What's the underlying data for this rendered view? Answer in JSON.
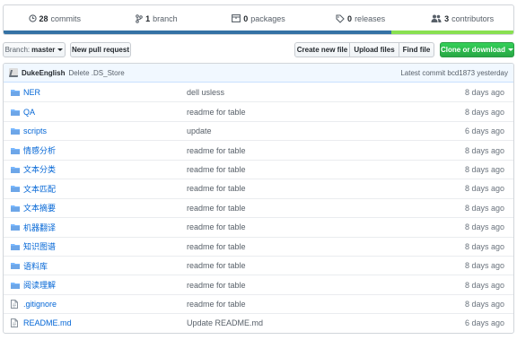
{
  "summary": {
    "commits_count": "28",
    "commits_label": "commits",
    "branch_count": "1",
    "branch_label": "branch",
    "packages_count": "0",
    "packages_label": "packages",
    "releases_count": "0",
    "releases_label": "releases",
    "contributors_count": "3",
    "contributors_label": "contributors",
    "language_colors": [
      "#3572a5",
      "#89e051"
    ]
  },
  "toolbar": {
    "branch_prefix": "Branch:",
    "branch_name": "master",
    "new_pull_request": "New pull request",
    "create_new_file": "Create new file",
    "upload_files": "Upload files",
    "find_file": "Find file",
    "clone_or_download": "Clone or download"
  },
  "commit": {
    "author": "DukeEnglish",
    "message": "Delete .DS_Store",
    "latest_label": "Latest commit",
    "sha": "bcd1873",
    "time": "yesterday"
  },
  "files": [
    {
      "type": "folder",
      "name": "NER",
      "message": "dell usless",
      "age": "8 days ago"
    },
    {
      "type": "folder",
      "name": "QA",
      "message": "readme for table",
      "age": "8 days ago"
    },
    {
      "type": "folder",
      "name": "scripts",
      "message": "update",
      "age": "6 days ago"
    },
    {
      "type": "folder",
      "name": "情感分析",
      "message": "readme for table",
      "age": "8 days ago"
    },
    {
      "type": "folder",
      "name": "文本分类",
      "message": "readme for table",
      "age": "8 days ago"
    },
    {
      "type": "folder",
      "name": "文本匹配",
      "message": "readme for table",
      "age": "8 days ago"
    },
    {
      "type": "folder",
      "name": "文本摘要",
      "message": "readme for table",
      "age": "8 days ago"
    },
    {
      "type": "folder",
      "name": "机器翻译",
      "message": "readme for table",
      "age": "8 days ago"
    },
    {
      "type": "folder",
      "name": "知识图谱",
      "message": "readme for table",
      "age": "8 days ago"
    },
    {
      "type": "folder",
      "name": "语料库",
      "message": "readme for table",
      "age": "8 days ago"
    },
    {
      "type": "folder",
      "name": "阅读理解",
      "message": "readme for table",
      "age": "8 days ago"
    },
    {
      "type": "file",
      "name": ".gitignore",
      "message": "readme for table",
      "age": "8 days ago"
    },
    {
      "type": "file",
      "name": "README.md",
      "message": "Update README.md",
      "age": "6 days ago"
    }
  ]
}
